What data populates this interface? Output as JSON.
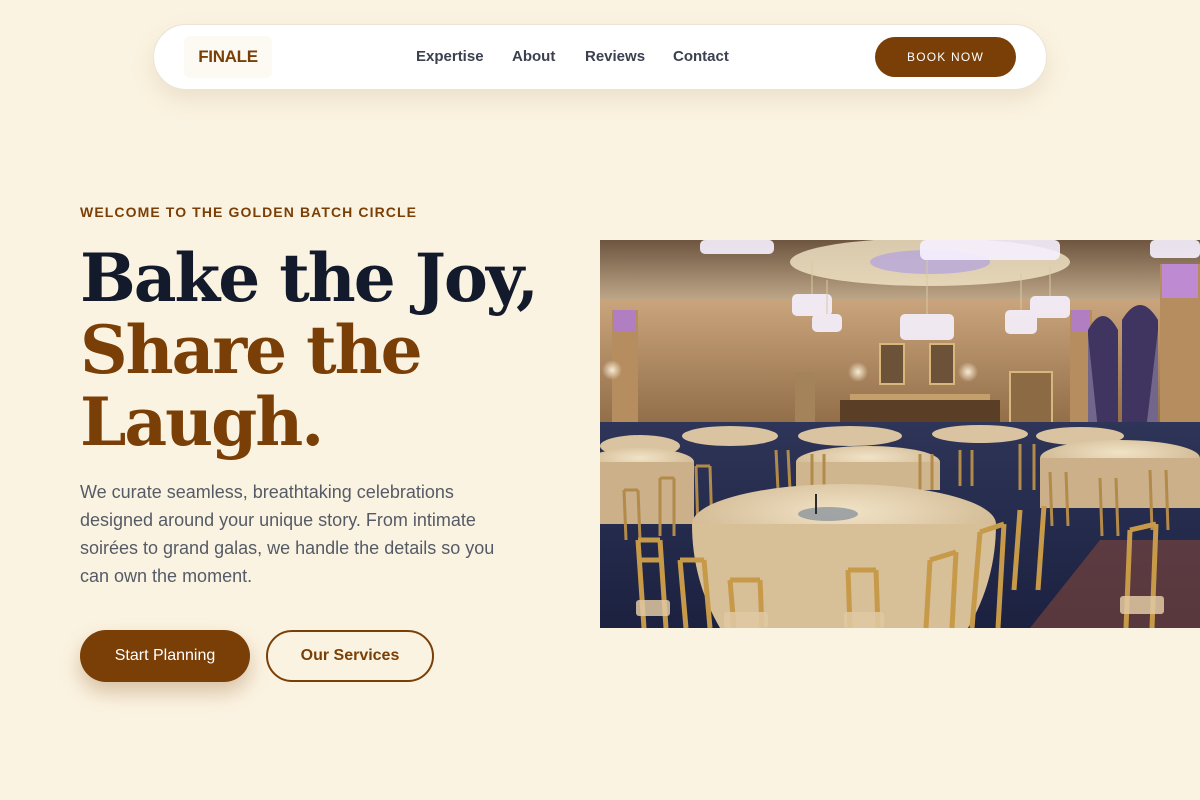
{
  "nav": {
    "logo": "FINALE",
    "links": [
      "Expertise",
      "About",
      "Reviews",
      "Contact"
    ],
    "cta": "BOOK NOW"
  },
  "hero": {
    "eyebrow": "WELCOME TO THE GOLDEN BATCH CIRCLE",
    "headline_line1": "Bake the Joy,",
    "headline_line2a": "Share the",
    "headline_line2b": "Laugh.",
    "description": "We curate seamless, breathtaking celebrations designed around your unique story. From intimate soirées to grand galas, we handle the details so you can own the moment.",
    "primary_button": "Start Planning",
    "secondary_button": "Our Services",
    "image_subject": "banquet hall with round tables, gold chiavari chairs and crystal chandeliers"
  },
  "colors": {
    "background": "#fbf3e1",
    "brand_brown": "#7a3f06",
    "headline_dark": "#121a2b",
    "body_text": "#555b66"
  }
}
